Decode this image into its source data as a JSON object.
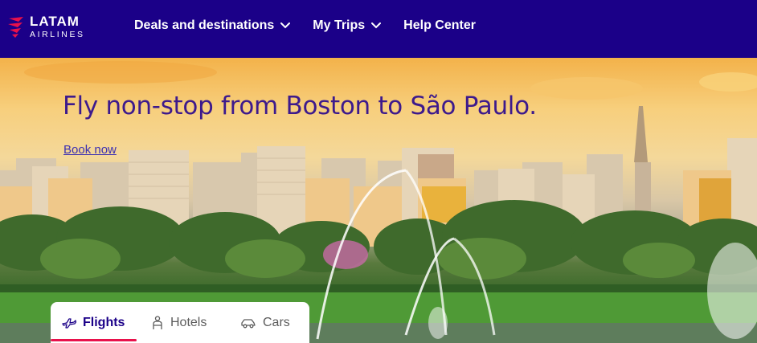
{
  "brand": {
    "logo_main": "LATAM",
    "logo_sub": "AIRLINES",
    "colors": {
      "navy": "#1b0088",
      "coral": "#e8114b",
      "headline": "#3d1a8c"
    }
  },
  "nav": {
    "items": [
      {
        "label": "Deals and destinations",
        "icon": "chevron-down-icon"
      },
      {
        "label": "My Trips",
        "icon": "chevron-down-icon"
      },
      {
        "label": "Help Center"
      }
    ]
  },
  "hero": {
    "headline": "Fly non-stop from Boston to São Paulo.",
    "cta": "Book now"
  },
  "booking": {
    "tabs": [
      {
        "label": "Flights",
        "icon": "plane-icon",
        "active": true
      },
      {
        "label": "Hotels",
        "icon": "bellhop-icon",
        "active": false
      },
      {
        "label": "Cars",
        "icon": "car-icon",
        "active": false
      }
    ]
  }
}
